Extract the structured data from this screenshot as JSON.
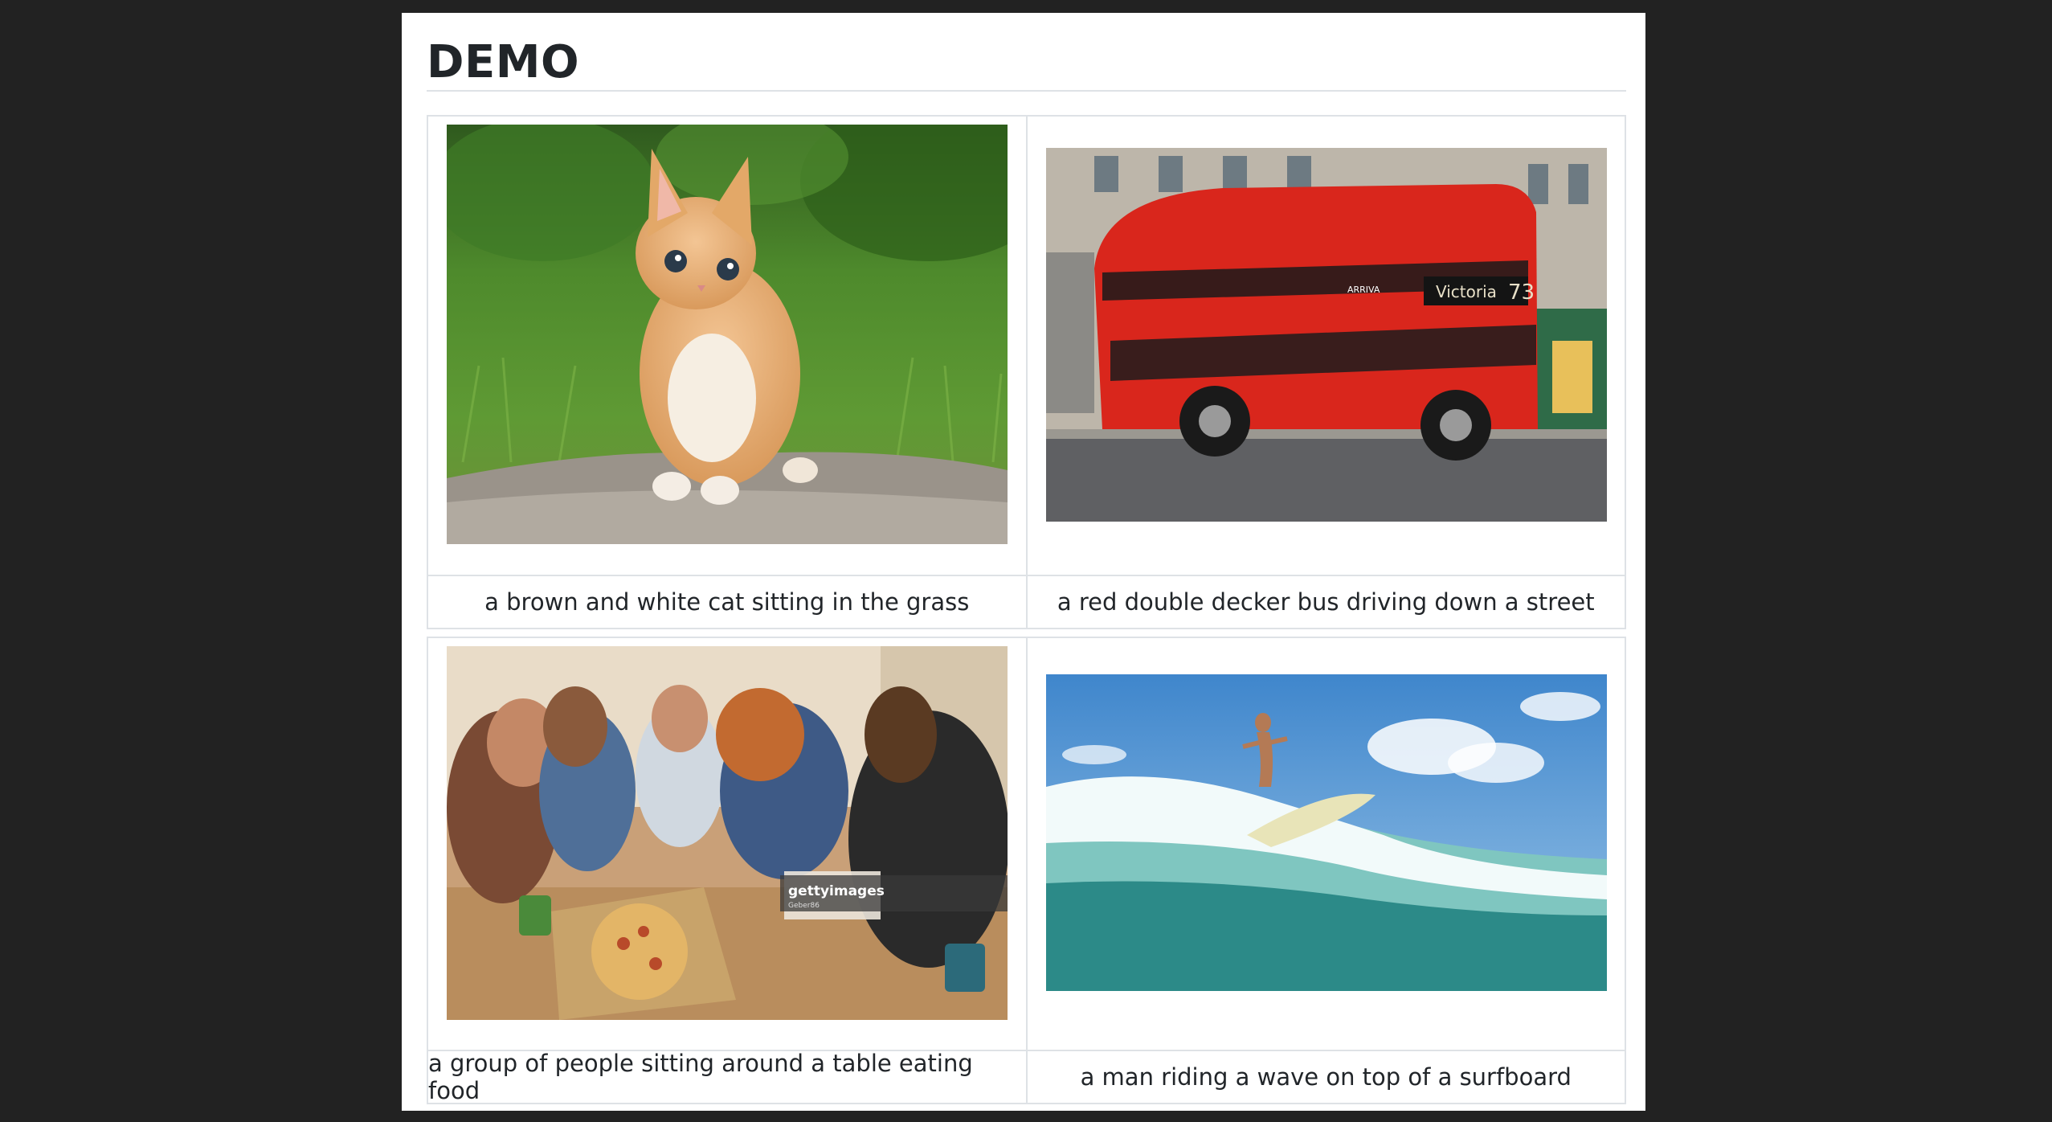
{
  "page": {
    "title": "DEMO"
  },
  "gallery": [
    {
      "image_subject": "orange kitten on rock in grass",
      "caption": "a brown and white cat sitting in the grass"
    },
    {
      "image_subject": "red double decker bus on street",
      "caption": "a red double decker bus driving down a street",
      "bus_sign": "Victoria",
      "bus_route": "73",
      "bus_brand": "ARRIVA"
    },
    {
      "image_subject": "group of friends eating pizza at table",
      "caption": "a group of people sitting around a table eating food",
      "watermark": "gettyimages",
      "watermark_credit": "Geber86"
    },
    {
      "image_subject": "surfer riding wave",
      "caption": "a man riding a wave on top of a surfboard"
    }
  ],
  "colors": {
    "background": "#222222",
    "panel": "#ffffff",
    "border": "#dee2e6",
    "text": "#212529",
    "bus_red": "#d9261c"
  }
}
